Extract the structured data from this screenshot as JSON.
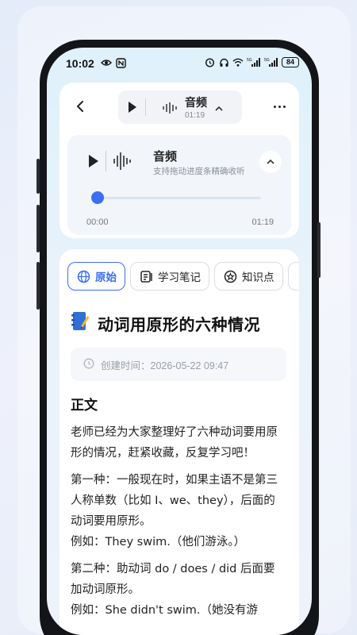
{
  "status_bar": {
    "time": "10:02",
    "battery": "84",
    "icons": [
      "eye-icon",
      "nfc-icon",
      "alarm-icon",
      "headphones-icon",
      "wifi-icon",
      "signal-5g-icon",
      "signal-5g-icon",
      "battery-icon"
    ]
  },
  "header": {
    "back_icon": "chevron-left-icon",
    "mini_player": {
      "title": "音频",
      "duration": "01:19"
    },
    "more_icon": "more-horizontal-icon"
  },
  "player": {
    "title": "音频",
    "subtitle": "支持拖动进度条精确收听",
    "current_time": "00:00",
    "total_time": "01:19",
    "progress": 0,
    "accent_color": "#3a6ff2"
  },
  "tabs": [
    {
      "label": "原始",
      "icon": "globe-icon",
      "active": true
    },
    {
      "label": "学习笔记",
      "icon": "notes-icon",
      "active": false
    },
    {
      "label": "知识点",
      "icon": "star-icon",
      "active": false
    }
  ],
  "document": {
    "title": "动词用原形的六种情况",
    "created_label": "创建时间：",
    "created_value": "2026-05-22 09:47",
    "section_title": "正文",
    "paragraphs": [
      [
        "老师已经为大家整理好了六种动词要用原",
        "形的情况，赶紧收藏，反复学习吧！"
      ],
      [
        "第一种：一般现在时，如果主语不是第三",
        "人称单数（比如 I、we、they），后面的",
        "动词要用原形。",
        "例如：They swim.（他们游泳。）"
      ],
      [
        "第二种：助动词 do / does / did 后面要",
        "加动词原形。",
        "例如：She didn't swim.（她没有游"
      ]
    ]
  }
}
